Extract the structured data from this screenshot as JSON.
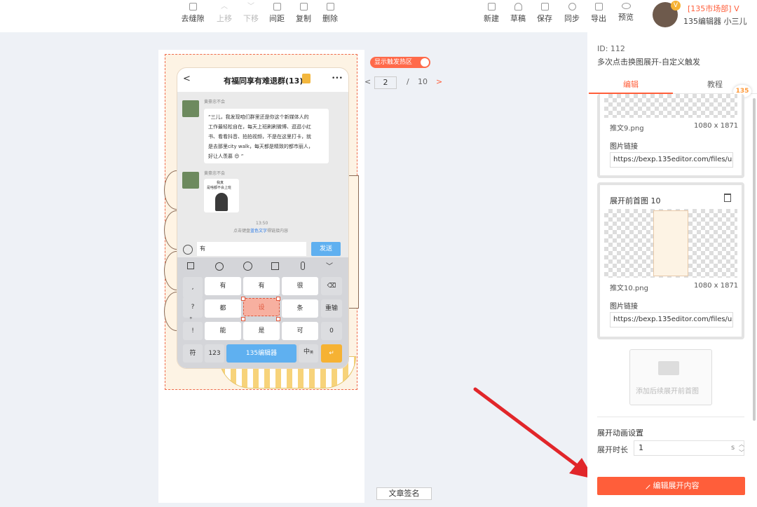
{
  "toolbar": {
    "left_buttons": [
      "去缝隙",
      "上移",
      "下移",
      "间距",
      "复制",
      "删除"
    ],
    "right_buttons": [
      "新建",
      "草稿",
      "保存",
      "同步",
      "导出",
      "预览"
    ]
  },
  "account": {
    "org": "[135市场部] V",
    "user": "135编辑器 小三儿",
    "badge": "V"
  },
  "canvas": {
    "hot_toggle_label": "显示触发热区",
    "pager": {
      "prev": "<",
      "current": "2",
      "sep": "/",
      "total": "10",
      "next": ">"
    },
    "sign_button": "文章签名"
  },
  "phone": {
    "title": "有福同享有难退群(13)",
    "more": "•••",
    "back": "<",
    "sender1": "黄豪忠不会",
    "msg_lines": [
      "“三儿，我发现咱们群里还是你这个新媒体人的",
      "工作最轻松自在，每天上班刷刷微博、逛逛小红",
      "书、看看抖音、拍拍视频，不是在这里打卡，就",
      "是去那里city walk，每天都是精致的都市丽人，",
      "好让人羡慕 😍 ”"
    ],
    "sender2": "黄豪忠不会",
    "sticker_top": "我真",
    "sticker_mid": "是啥都不会上班",
    "time": "13:50",
    "tip_pre": "点击键盘",
    "tip_link": "蓝色文字",
    "tip_post": "得链接内容",
    "input_text": "有",
    "send": "发送",
    "keys": {
      "r1": [
        "有",
        "有",
        "很"
      ],
      "r2": [
        "都",
        "设",
        "条"
      ],
      "r3": [
        "能",
        "是",
        "可"
      ],
      "left_col": [
        ",",
        "?",
        "。",
        "!"
      ],
      "right_col": [
        "⌫",
        "重输",
        "0"
      ],
      "bottom": [
        "符",
        "123",
        "135编辑器",
        "中",
        "↵"
      ],
      "bottom_sub": "英"
    }
  },
  "panel": {
    "id": "ID: 112",
    "desc": "多次点击换图展开-自定义触发",
    "tabs": [
      "编辑",
      "教程"
    ],
    "logo": "135",
    "card1": {
      "file": "推文9.png",
      "size": "1080 x 1871",
      "link_label": "图片链接",
      "url": "https://bexp.135editor.com/files/user"
    },
    "card2": {
      "title": "展开前首图 10",
      "file": "推文10.png",
      "size": "1080 x 1871",
      "link_label": "图片链接",
      "url": "https://bexp.135editor.com/files/user"
    },
    "add_image": "添加后续展开前首图",
    "anim_title": "展开动画设置",
    "duration_label": "展开时长",
    "duration_value": "1",
    "duration_unit": "s",
    "edit_button": "编辑展开内容"
  }
}
